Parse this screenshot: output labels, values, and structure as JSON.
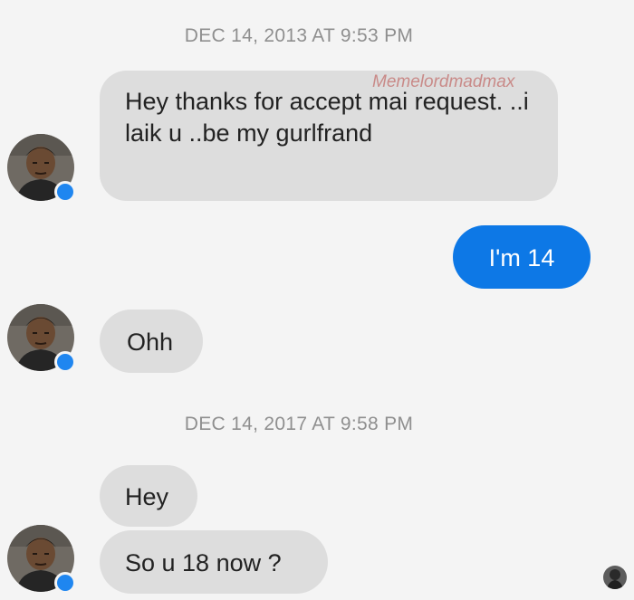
{
  "conversation": {
    "timestamp_1": "DEC 14, 2013 AT 9:53 PM",
    "watermark": "Memelordmadmax",
    "messages": {
      "m1": "Hey thanks for accept mai request. ..i laik u ..be my gurlfrand",
      "m2": "I'm  14",
      "m3": "Ohh",
      "m4": "Hey",
      "m5": "So u 18 now ?"
    },
    "timestamp_2": "DEC 14, 2017 AT 9:58 PM"
  },
  "colors": {
    "background": "#f4f4f4",
    "incoming_bubble": "#dddddd",
    "outgoing_bubble": "#0d78e6",
    "timestamp_text": "#8f8f8f",
    "badge": "#1f86f0"
  },
  "icons": {
    "avatar": "contact-avatar-icon",
    "badge": "messenger-badge-icon",
    "seen": "seen-avatar-icon"
  }
}
